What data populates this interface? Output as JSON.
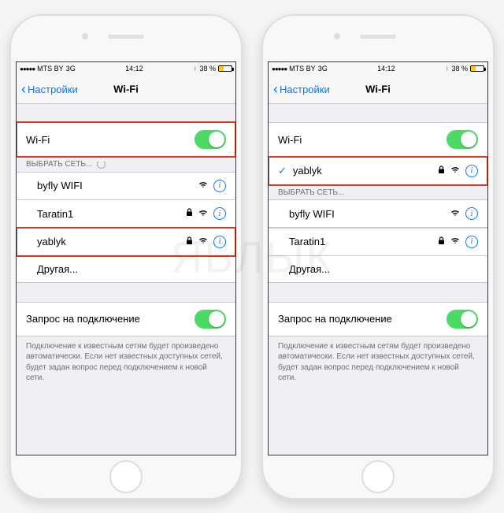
{
  "watermark": "ЯБЛЫК",
  "status": {
    "carrier": "MTS BY",
    "net": "3G",
    "time": "14:12",
    "battery": "38 %"
  },
  "nav": {
    "back": "Настройки",
    "title": "Wi-Fi"
  },
  "wifi_label": "Wi-Fi",
  "choose_header": "ВЫБРАТЬ СЕТЬ...",
  "networks": {
    "byfly": "byfly WIFI",
    "taratin": "Taratin1",
    "yablyk": "yablyk",
    "other": "Другая..."
  },
  "ask_label": "Запрос на подключение",
  "footer": "Подключение к известным сетям будет произведено автоматически. Если нет известных доступных сетей, будет задан вопрос перед подключением к новой сети."
}
